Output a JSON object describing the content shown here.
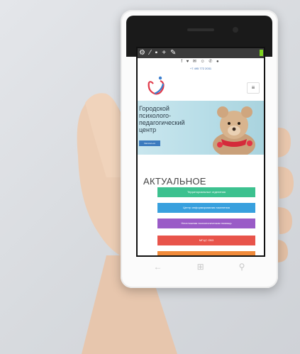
{
  "toolbar": {
    "icons": [
      "tools-icon",
      "brush-icon",
      "comment-icon",
      "add-icon",
      "pencil-icon"
    ]
  },
  "site": {
    "social_icons": "f ♥ ✉ ☺ ✆ ●",
    "phone": "+7 495 772 2031",
    "menu_icon": "≡",
    "banner": {
      "lines": [
        "Городской",
        "психолого-",
        "педагогический",
        "центр"
      ],
      "button": "Записаться"
    },
    "section_title": "АКТУАЛЬНОЕ",
    "buttons": [
      {
        "label": "Территориальные отделения",
        "color": "#3cc18f"
      },
      {
        "label": "Центр информирования населения",
        "color": "#38a0de"
      },
      {
        "label": "Неотложная психологическая помощь",
        "color": "#9a5bc7"
      },
      {
        "label": "МГЦС ОВЗ",
        "color": "#e8544b"
      },
      {
        "label": "",
        "color": "#f08a3a"
      }
    ]
  },
  "phone_nav": {
    "back": "←",
    "home": "⊞",
    "search": "⚲"
  }
}
